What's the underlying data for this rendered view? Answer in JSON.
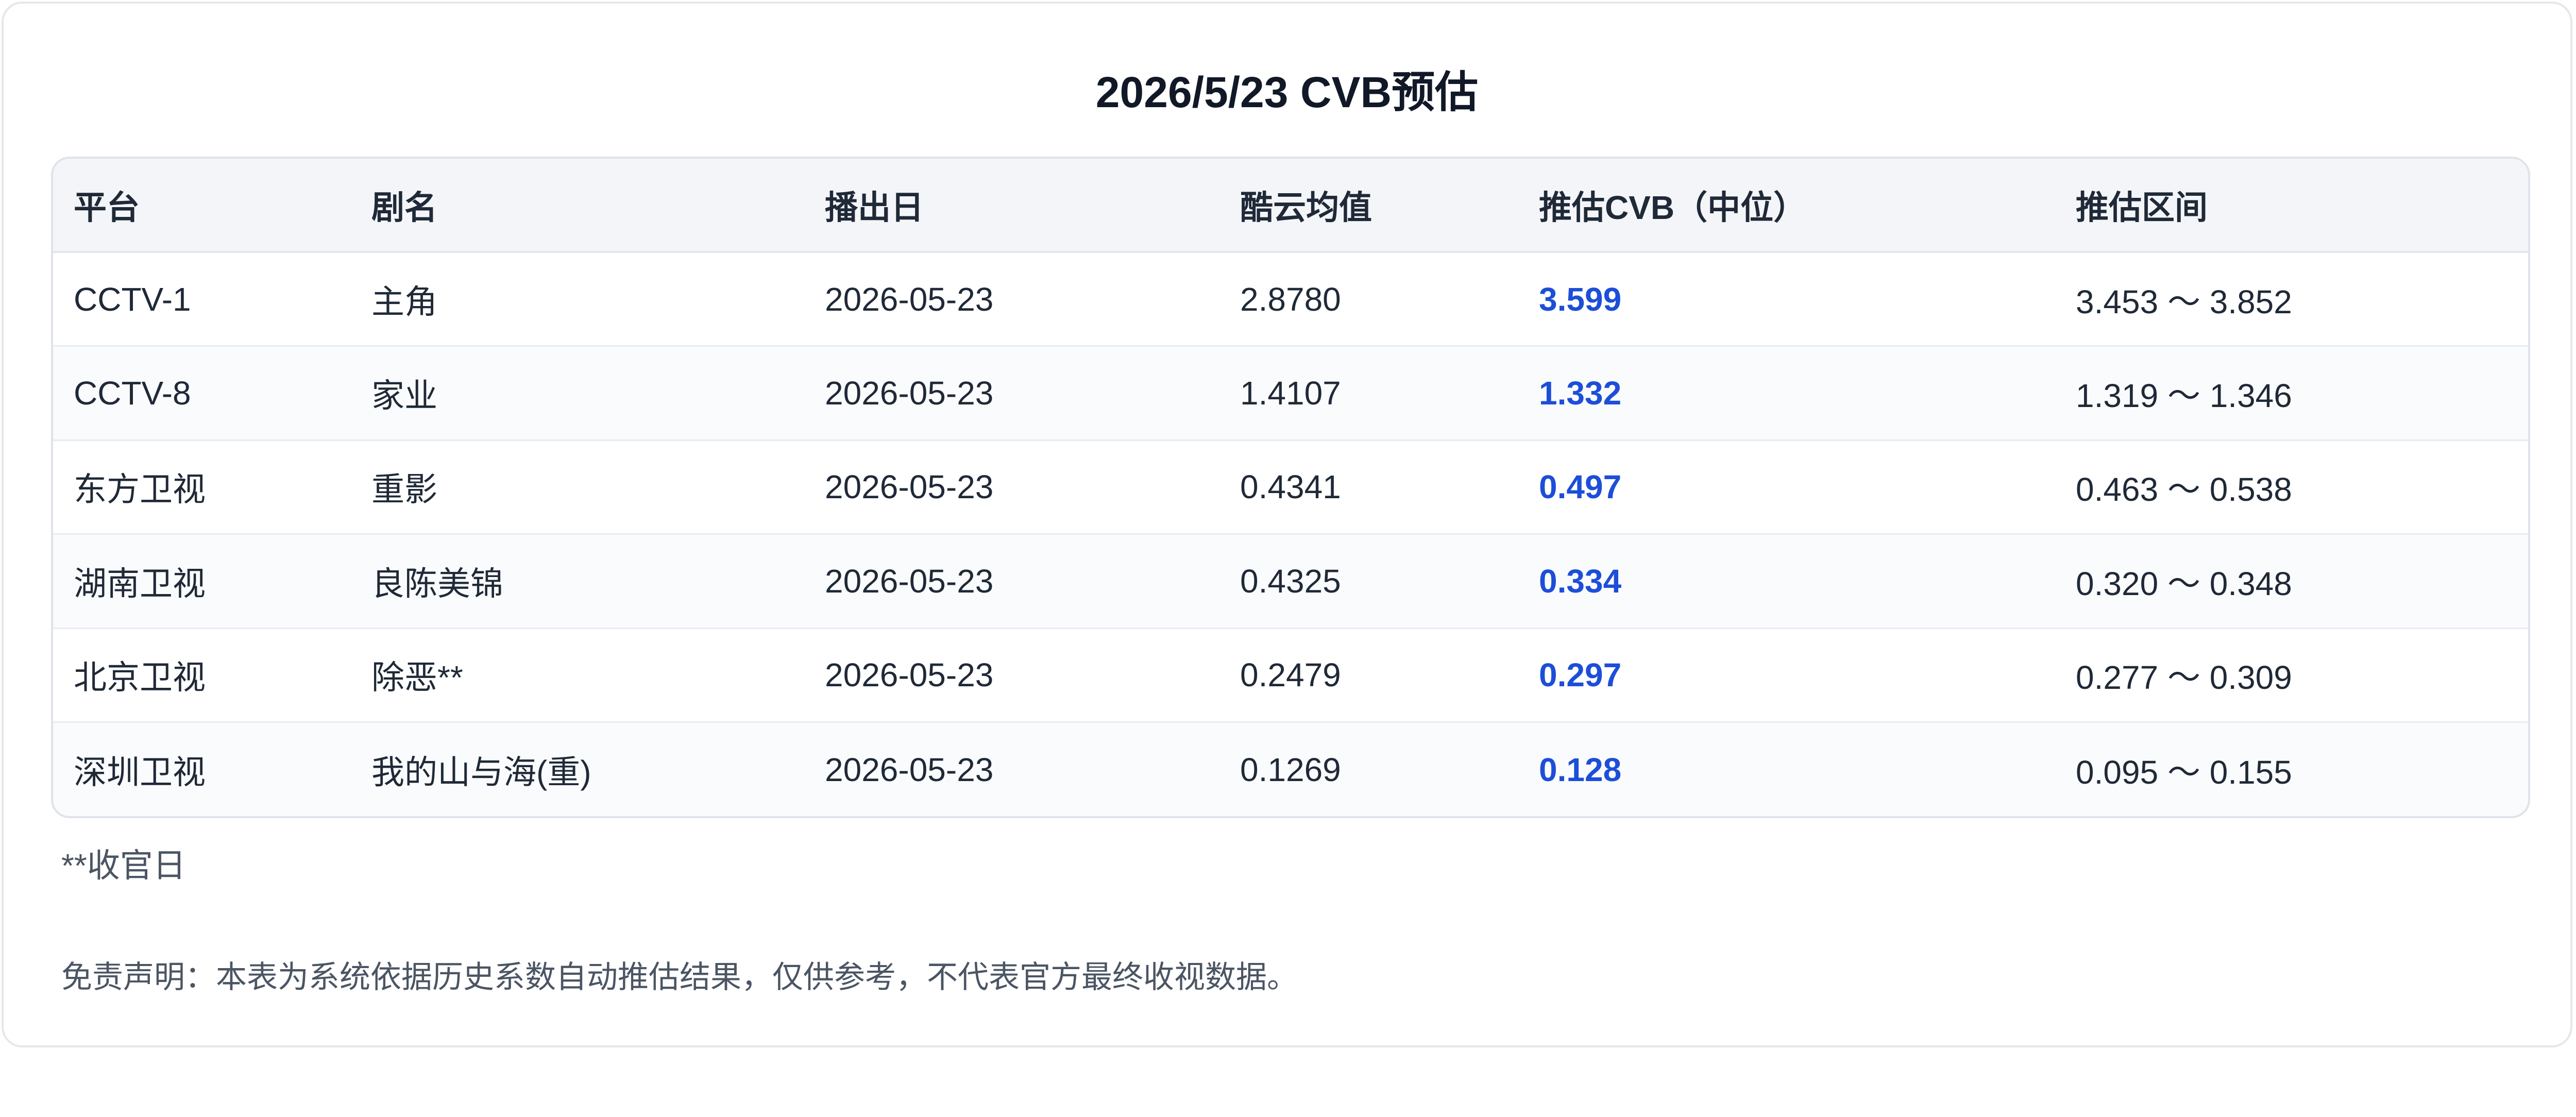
{
  "title": "2026/5/23 CVB预估",
  "table": {
    "headers": [
      "平台",
      "剧名",
      "播出日",
      "酷云均值",
      "推估CVB（中位）",
      "推估区间"
    ],
    "rows": [
      [
        "CCTV-1",
        "主角",
        "2026-05-23",
        "2.8780",
        "3.599",
        "3.453 ～ 3.852"
      ],
      [
        "CCTV-8",
        "家业",
        "2026-05-23",
        "1.4107",
        "1.332",
        "1.319 ～ 1.346"
      ],
      [
        "东方卫视",
        "重影",
        "2026-05-23",
        "0.4341",
        "0.497",
        "0.463 ～ 0.538"
      ],
      [
        "湖南卫视",
        "良陈美锦",
        "2026-05-23",
        "0.4325",
        "0.334",
        "0.320 ～ 0.348"
      ],
      [
        "北京卫视",
        "除恶**",
        "2026-05-23",
        "0.2479",
        "0.297",
        "0.277 ～ 0.309"
      ],
      [
        "深圳卫视",
        "我的山与海(重)",
        "2026-05-23",
        "0.1269",
        "0.128",
        "0.095 ～ 0.155"
      ]
    ]
  },
  "note": "**收官日",
  "disclaimer": "免责声明：本表为系统依据历史系数自动推估结果，仅供参考，不代表官方最终收视数据。",
  "colors": {
    "cvb_value": "#1d4ed8",
    "header_bg": "#f3f5f8",
    "border": "#dfe3ea"
  }
}
